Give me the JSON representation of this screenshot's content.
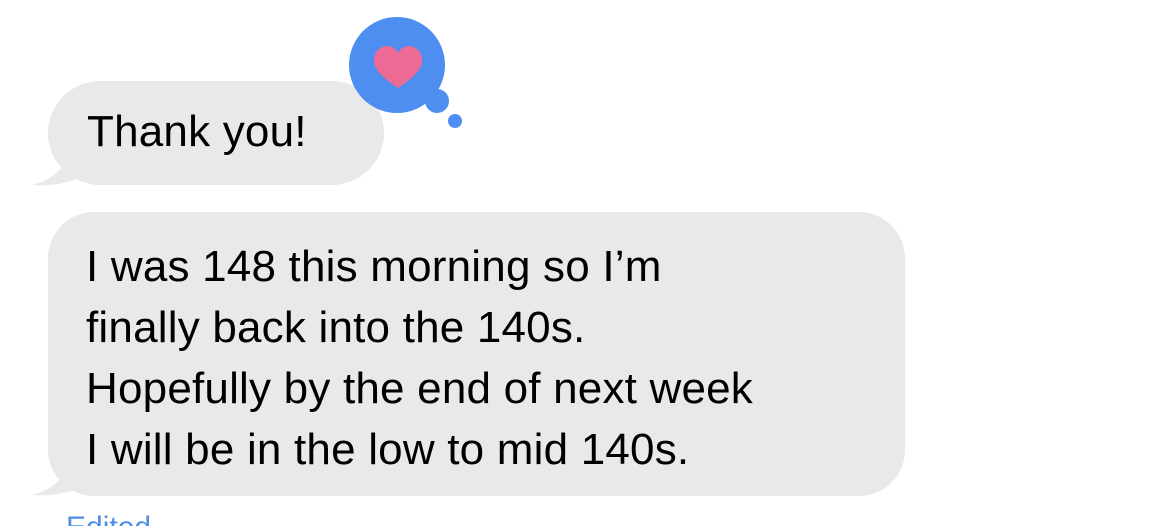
{
  "messages": [
    {
      "sender": "other",
      "lines": [
        "Thank you!"
      ],
      "reaction": "heart"
    },
    {
      "sender": "other",
      "lines": [
        "I was 148 this morning so I’m",
        "finally back into the 140s.",
        "Hopefully by the end of next week",
        "I will be in the low to mid 140s."
      ]
    }
  ],
  "status": {
    "edited": "Edited"
  },
  "colors": {
    "bubble_gray": "#e9e9eb",
    "tapback_blue": "#4d8ef0",
    "heart_pink": "#ec6a93",
    "edited_blue": "#4f8de8"
  },
  "icons": {
    "reaction": "heart-icon"
  }
}
